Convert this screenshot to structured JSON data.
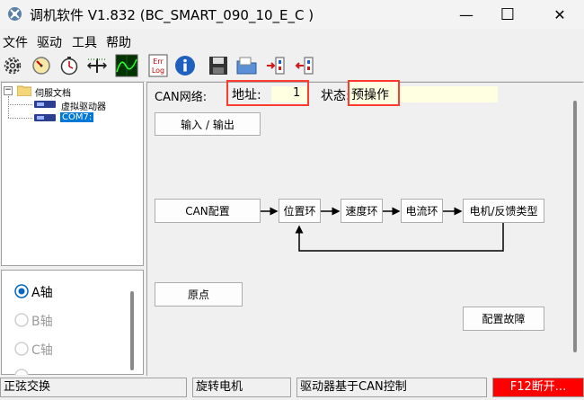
{
  "window": {
    "title": "调机软件 V1.832 (BC_SMART_090_10_E_C )",
    "minimize": "—",
    "maximize": "☐",
    "close": "✕"
  },
  "menu": [
    "文件",
    "驱动",
    "工具",
    "帮助"
  ],
  "toolbar": {
    "icons": [
      "gear-icon",
      "gauge-icon",
      "timer-icon",
      "crosshair-icon",
      "oscilloscope-icon",
      "error-log-icon",
      "info-icon",
      "save-icon",
      "open-folder-icon",
      "download-icon",
      "upload-icon"
    ],
    "err_label_1": "Err",
    "err_label_2": "Log"
  },
  "tree": {
    "root": "伺服文档",
    "children": [
      "虚拟驱动器",
      "COM7:"
    ]
  },
  "axes": [
    "A轴",
    "B轴",
    "C轴"
  ],
  "main": {
    "can_network_label": "CAN网络:",
    "address_label": "地址:",
    "address_value": "1",
    "status_label": "状态:",
    "status_value": "预操作",
    "io_button": "输入 / 输出",
    "can_config_button": "CAN配置",
    "position_loop": "位置环",
    "speed_loop": "速度环",
    "current_loop": "电流环",
    "motor_feedback": "电机/反馈类型",
    "origin_button": "原点",
    "fault_config_button": "配置故障"
  },
  "statusbar": {
    "comm": "正弦交换",
    "motor": "旋转电机",
    "control": "驱动器基于CAN控制",
    "f12": "F12断开..."
  },
  "colors": {
    "highlight_red": "#ff3b30",
    "status_field_bg": "#ffffe1",
    "selection_blue": "#0078d7",
    "f12_bg": "#ff0000"
  }
}
